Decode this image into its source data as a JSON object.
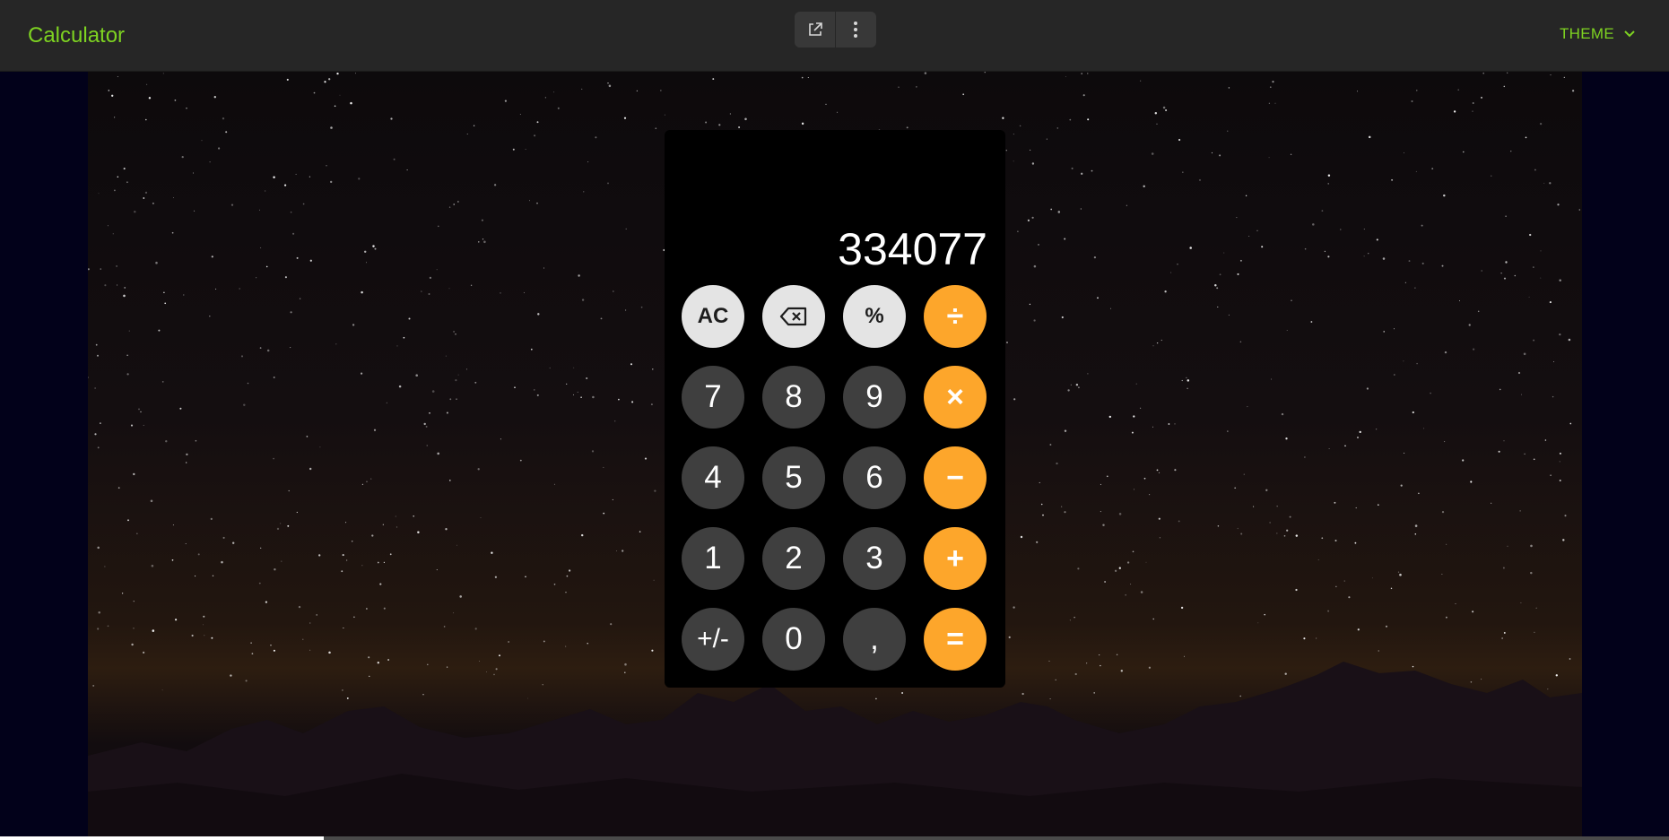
{
  "header": {
    "title": "Calculator",
    "theme_label": "THEME",
    "open_external_icon": "open-external-icon",
    "more_icon": "more-vertical-icon",
    "chevron_icon": "chevron-down-icon"
  },
  "colors": {
    "accent": "#7ed321",
    "operator": "#fda62b",
    "function_key": "#e4e4e4",
    "digit_key": "#3f3f3f",
    "topbar": "#262626"
  },
  "calculator": {
    "display": "334077",
    "keys": {
      "ac": "AC",
      "backspace_icon": "backspace-icon",
      "percent": "%",
      "divide": "÷",
      "seven": "7",
      "eight": "8",
      "nine": "9",
      "multiply": "×",
      "four": "4",
      "five": "5",
      "six": "6",
      "minus": "−",
      "one": "1",
      "two": "2",
      "three": "3",
      "plus": "+",
      "negate": "+/-",
      "zero": "0",
      "decimal": ",",
      "equals": "="
    }
  }
}
